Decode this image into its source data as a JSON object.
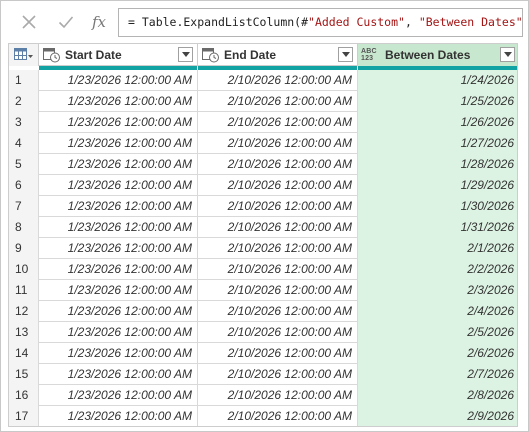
{
  "formula": {
    "prefix": "= Table.ExpandListColumn(#",
    "arg1": "\"Added Custom\"",
    "sep": ", ",
    "arg2": "\"Between Dates\"",
    "suffix": ")",
    "cancel_icon": "close-icon",
    "commit_icon": "check-icon",
    "fx_label": "fx"
  },
  "columns": [
    {
      "label": "Start Date",
      "type_icon": "datetime-icon"
    },
    {
      "label": "End Date",
      "type_icon": "datetime-icon"
    },
    {
      "label": "Between Dates",
      "type_icon": "any-type-icon",
      "type_text": "ABC\n123"
    }
  ],
  "rows": [
    {
      "n": "1",
      "start": "1/23/2026 12:00:00 AM",
      "end": "2/10/2026 12:00:00 AM",
      "between": "1/24/2026"
    },
    {
      "n": "2",
      "start": "1/23/2026 12:00:00 AM",
      "end": "2/10/2026 12:00:00 AM",
      "between": "1/25/2026"
    },
    {
      "n": "3",
      "start": "1/23/2026 12:00:00 AM",
      "end": "2/10/2026 12:00:00 AM",
      "between": "1/26/2026"
    },
    {
      "n": "4",
      "start": "1/23/2026 12:00:00 AM",
      "end": "2/10/2026 12:00:00 AM",
      "between": "1/27/2026"
    },
    {
      "n": "5",
      "start": "1/23/2026 12:00:00 AM",
      "end": "2/10/2026 12:00:00 AM",
      "between": "1/28/2026"
    },
    {
      "n": "6",
      "start": "1/23/2026 12:00:00 AM",
      "end": "2/10/2026 12:00:00 AM",
      "between": "1/29/2026"
    },
    {
      "n": "7",
      "start": "1/23/2026 12:00:00 AM",
      "end": "2/10/2026 12:00:00 AM",
      "between": "1/30/2026"
    },
    {
      "n": "8",
      "start": "1/23/2026 12:00:00 AM",
      "end": "2/10/2026 12:00:00 AM",
      "between": "1/31/2026"
    },
    {
      "n": "9",
      "start": "1/23/2026 12:00:00 AM",
      "end": "2/10/2026 12:00:00 AM",
      "between": "2/1/2026"
    },
    {
      "n": "10",
      "start": "1/23/2026 12:00:00 AM",
      "end": "2/10/2026 12:00:00 AM",
      "between": "2/2/2026"
    },
    {
      "n": "11",
      "start": "1/23/2026 12:00:00 AM",
      "end": "2/10/2026 12:00:00 AM",
      "between": "2/3/2026"
    },
    {
      "n": "12",
      "start": "1/23/2026 12:00:00 AM",
      "end": "2/10/2026 12:00:00 AM",
      "between": "2/4/2026"
    },
    {
      "n": "13",
      "start": "1/23/2026 12:00:00 AM",
      "end": "2/10/2026 12:00:00 AM",
      "between": "2/5/2026"
    },
    {
      "n": "14",
      "start": "1/23/2026 12:00:00 AM",
      "end": "2/10/2026 12:00:00 AM",
      "between": "2/6/2026"
    },
    {
      "n": "15",
      "start": "1/23/2026 12:00:00 AM",
      "end": "2/10/2026 12:00:00 AM",
      "between": "2/7/2026"
    },
    {
      "n": "16",
      "start": "1/23/2026 12:00:00 AM",
      "end": "2/10/2026 12:00:00 AM",
      "between": "2/8/2026"
    },
    {
      "n": "17",
      "start": "1/23/2026 12:00:00 AM",
      "end": "2/10/2026 12:00:00 AM",
      "between": "2/9/2026"
    }
  ],
  "colors": {
    "accent": "#11a3a3",
    "selected_header": "#c8e7cf",
    "selected_column": "#dcf2e2",
    "formula_string": "#a31515"
  }
}
